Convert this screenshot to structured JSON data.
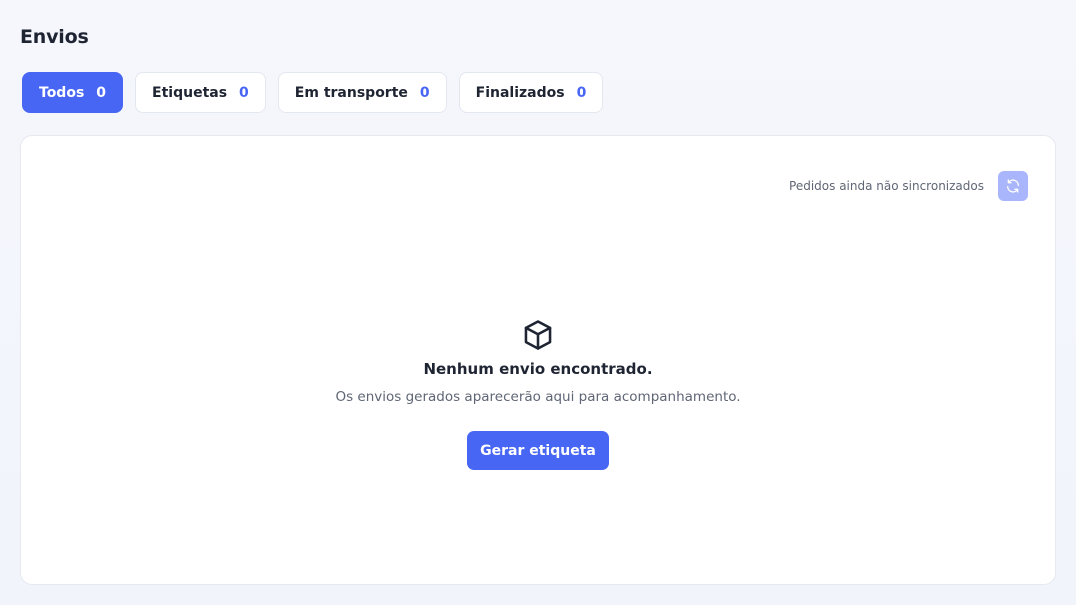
{
  "page": {
    "title": "Envios"
  },
  "tabs": [
    {
      "label": "Todos",
      "count": "0",
      "active": true
    },
    {
      "label": "Etiquetas",
      "count": "0",
      "active": false
    },
    {
      "label": "Em transporte",
      "count": "0",
      "active": false
    },
    {
      "label": "Finalizados",
      "count": "0",
      "active": false
    }
  ],
  "sync": {
    "text": "Pedidos ainda não sincronizados",
    "icon": "refresh-icon"
  },
  "empty_state": {
    "icon": "package-icon",
    "title": "Nenhum envio encontrado.",
    "subtitle": "Os envios gerados aparecerão aqui para acompanhamento.",
    "button_label": "Gerar etiqueta"
  },
  "colors": {
    "accent": "#4866f4",
    "accent_light": "#a9b6fb",
    "text": "#1f2433",
    "muted": "#5f6675"
  }
}
